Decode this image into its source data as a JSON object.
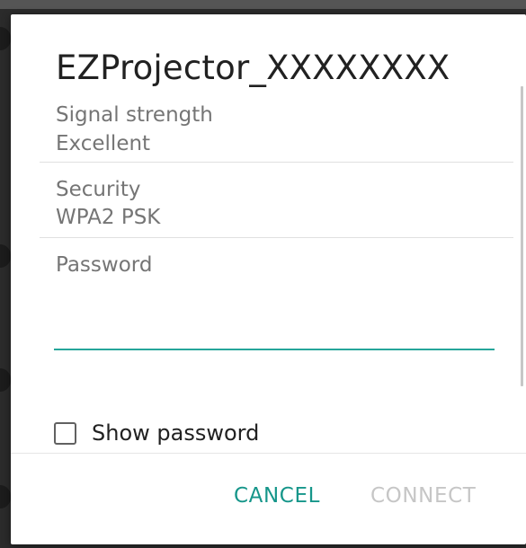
{
  "dialog": {
    "title": "EZProjector_XXXXXXXX",
    "signal": {
      "label": "Signal strength",
      "value": "Excellent"
    },
    "security": {
      "label": "Security",
      "value": "WPA2 PSK"
    },
    "password": {
      "label": "Password",
      "value": "",
      "placeholder": ""
    },
    "show_password": {
      "label": "Show password",
      "checked": false
    },
    "buttons": {
      "cancel": "CANCEL",
      "connect": "CONNECT"
    }
  },
  "colors": {
    "accent": "#16968a",
    "disabled": "#c6c6c6",
    "secondary_text": "#757575",
    "primary_text": "#212121"
  }
}
